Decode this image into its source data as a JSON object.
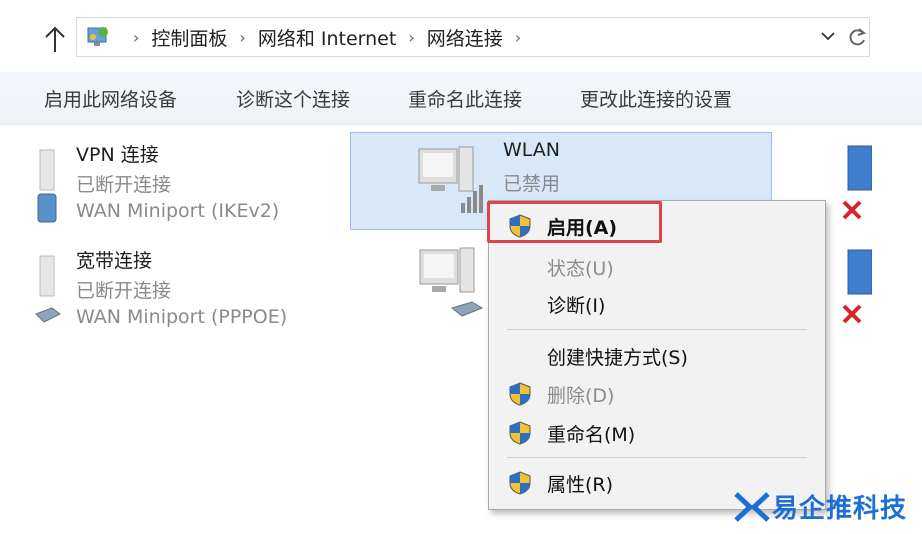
{
  "address_bar": {
    "breadcrumbs": [
      "控制面板",
      "网络和 Internet",
      "网络连接"
    ]
  },
  "toolbar": {
    "commands": [
      "启用此网络设备",
      "诊断这个连接",
      "重命名此连接",
      "更改此连接的设置"
    ]
  },
  "connections": [
    {
      "name": "VPN 连接",
      "status": "已断开连接",
      "device": "WAN Miniport (IKEv2)"
    },
    {
      "name": "宽带连接",
      "status": "已断开连接",
      "device": "WAN Miniport (PPPOE)"
    },
    {
      "name": "WLAN",
      "status": "已禁用",
      "device": ""
    }
  ],
  "context_menu": {
    "items": [
      {
        "label": "启用(A)",
        "shield": true,
        "disabled": false,
        "bold": true
      },
      {
        "label": "状态(U)",
        "shield": false,
        "disabled": true,
        "bold": false
      },
      {
        "label": "诊断(I)",
        "shield": false,
        "disabled": false,
        "bold": false
      },
      {
        "label": "创建快捷方式(S)",
        "shield": false,
        "disabled": false,
        "bold": false
      },
      {
        "label": "删除(D)",
        "shield": true,
        "disabled": true,
        "bold": false
      },
      {
        "label": "重命名(M)",
        "shield": true,
        "disabled": false,
        "bold": false
      },
      {
        "label": "属性(R)",
        "shield": true,
        "disabled": false,
        "bold": false
      }
    ]
  },
  "watermark": {
    "text": "易企推科技"
  },
  "colors": {
    "highlight_box": "#e0444a",
    "selection": "#d8e8f8",
    "watermark": "#1d6fd6"
  }
}
